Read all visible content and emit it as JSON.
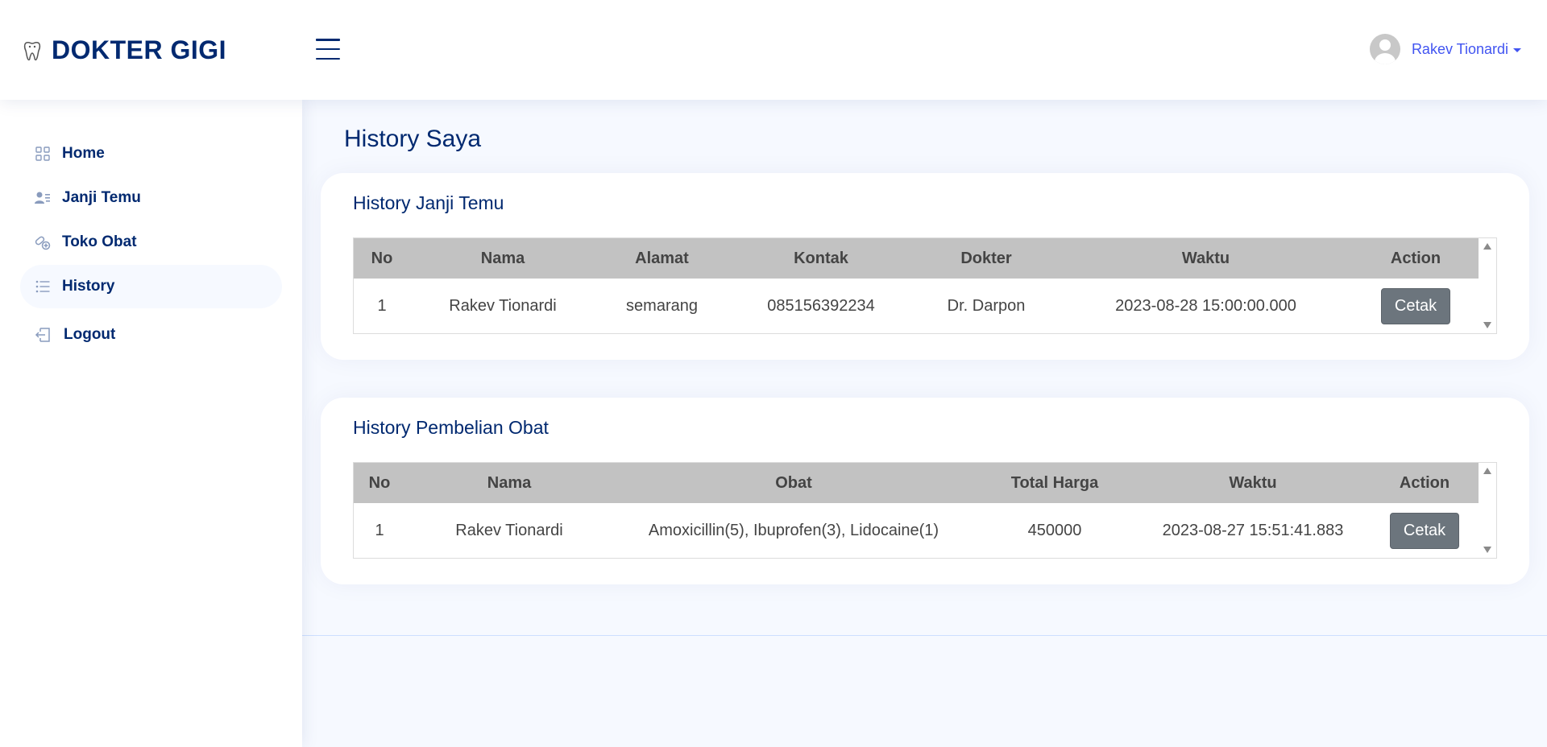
{
  "brand": {
    "name": "DOKTER GIGI",
    "logo_icon": "tooth-icon"
  },
  "header": {
    "user_name": "Rakev Tionardi"
  },
  "sidebar": {
    "items": [
      {
        "label": "Home",
        "icon": "grid-icon"
      },
      {
        "label": "Janji Temu",
        "icon": "person-lines-icon"
      },
      {
        "label": "Toko Obat",
        "icon": "capsule-icon"
      },
      {
        "label": "History",
        "icon": "list-icon",
        "active": true
      },
      {
        "label": "Logout",
        "icon": "box-arrow-left-icon"
      }
    ]
  },
  "page": {
    "title": "History Saya"
  },
  "janji_temu": {
    "title": "History Janji Temu",
    "columns": [
      "No",
      "Nama",
      "Alamat",
      "Kontak",
      "Dokter",
      "Waktu",
      "Action"
    ],
    "rows": [
      {
        "no": "1",
        "nama": "Rakev Tionardi",
        "alamat": "semarang",
        "kontak": "085156392234",
        "dokter": "Dr. Darpon",
        "waktu": "2023-08-28 15:00:00.000",
        "action": "Cetak"
      }
    ]
  },
  "pembelian_obat": {
    "title": "History Pembelian Obat",
    "columns": [
      "No",
      "Nama",
      "Obat",
      "Total Harga",
      "Waktu",
      "Action"
    ],
    "rows": [
      {
        "no": "1",
        "nama": "Rakev Tionardi",
        "obat": "Amoxicillin(5), Ibuprofen(3), Lidocaine(1)",
        "total_harga": "450000",
        "waktu": "2023-08-27 15:51:41.883",
        "action": "Cetak"
      }
    ]
  },
  "colors": {
    "primary": "#012970",
    "accent": "#4154f1",
    "button": "#6c757d",
    "table_header": "#c2c2c2",
    "background": "#f6f9ff"
  }
}
